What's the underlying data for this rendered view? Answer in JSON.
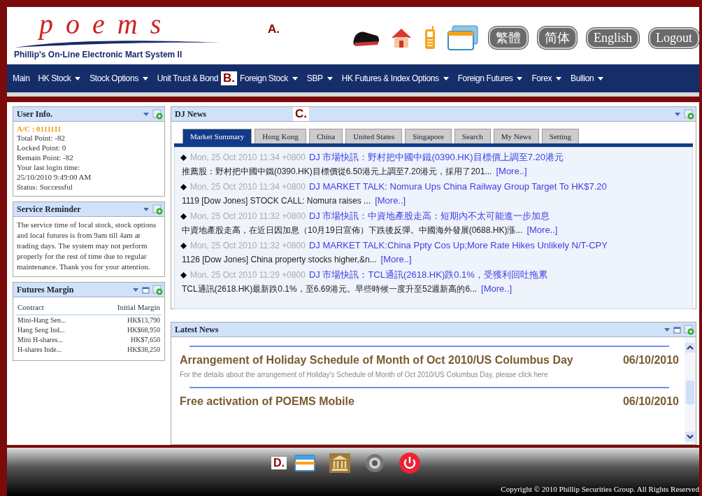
{
  "header": {
    "logo": "poems",
    "logo_subtitle": "Phillip's On-Line Electronic Mart System II",
    "callout": "A.",
    "buttons": [
      "繁體",
      "简体",
      "English",
      "Logout"
    ]
  },
  "nav": {
    "items": [
      {
        "kind": "item",
        "label": "Main",
        "dropdown": false
      },
      {
        "kind": "item",
        "label": "HK Stock",
        "dropdown": true
      },
      {
        "kind": "item",
        "label": "Stock Options",
        "dropdown": true
      },
      {
        "kind": "item",
        "label": "Unit Trust & Bond",
        "dropdown": false
      },
      {
        "kind": "callout",
        "label": "B."
      },
      {
        "kind": "item",
        "label": "Foreign Stock",
        "dropdown": true
      },
      {
        "kind": "item",
        "label": "SBP",
        "dropdown": true
      },
      {
        "kind": "item",
        "label": "HK Futures & Index Options",
        "dropdown": true
      },
      {
        "kind": "item",
        "label": "Foreign Futures",
        "dropdown": true
      },
      {
        "kind": "item",
        "label": "Forex",
        "dropdown": true
      },
      {
        "kind": "item",
        "label": "Bullion",
        "dropdown": true
      }
    ]
  },
  "user_info": {
    "title": "User Info.",
    "account": "A/C : 0111111",
    "lines": [
      "Total Point: -82",
      "Locked Point: 0",
      "Remain Point: -82",
      "Your last login time:",
      "25/10/2010 9:49:00 AM",
      "Status: Successful"
    ]
  },
  "service_reminder": {
    "title": "Service Reminder",
    "text": "The service time of local stock, stock options and local futures is from 9am till 4am at trading days. The system may not perform properly for the rest of time due to regular maintenance. Thank you for your attention."
  },
  "futures_margin": {
    "title": "Futures Margin",
    "columns": [
      "Contract",
      "Initial Margin"
    ],
    "rows": [
      [
        "Mini-Hang Sen...",
        "HK$13,790"
      ],
      [
        "Hang Seng Ind...",
        "HK$68,950"
      ],
      [
        "Mini H-shares...",
        "HK$7,650"
      ],
      [
        "H-shares Inde...",
        "HK$38,250"
      ]
    ]
  },
  "dj_news": {
    "title": "DJ News",
    "callout": "C.",
    "tabs": [
      {
        "label": "Market Summary",
        "selected": true
      },
      {
        "label": "Hong Kong",
        "selected": false
      },
      {
        "label": "China",
        "selected": false
      },
      {
        "label": "United States",
        "selected": false
      },
      {
        "label": "Singapore",
        "selected": false
      },
      {
        "label": "Search",
        "selected": false
      },
      {
        "label": "My News",
        "selected": false
      },
      {
        "label": "Setting",
        "selected": false
      }
    ],
    "items": [
      {
        "time": "Mon, 25 Oct 2010 11:34 +0800",
        "headline": "DJ 市場快訊：野村把中國中鐵(0390.HK)目標價上調至7.20港元",
        "summary": "推薦股：野村把中國中鐵(0390.HK)目標價從6.50港元上調至7.20港元，採用了201...",
        "more": "[More..]"
      },
      {
        "time": "Mon, 25 Oct 2010 11:34 +0800",
        "headline": "DJ MARKET TALK: Nomura Ups China Railway Group Target To HK$7.20",
        "summary": "1119 [Dow Jones] STOCK CALL: Nomura raises ...",
        "more": "[More..]"
      },
      {
        "time": "Mon, 25 Oct 2010 11:32 +0800",
        "headline": "DJ 市場快訊：中資地產股走高：短期內不太可能進一步加息",
        "summary": "中資地產股走高，在近日因加息（10月19日宣佈）下跌後反彈。中國海外發展(0688.HK)漲...",
        "more": "[More..]"
      },
      {
        "time": "Mon, 25 Oct 2010 11:32 +0800",
        "headline": "DJ MARKET TALK:China Ppty Cos Up;More Rate Hikes Unlikely N/T-CPY",
        "summary": "1126 [Dow Jones] China property stocks higher,&n...",
        "more": "[More..]"
      },
      {
        "time": "Mon, 25 Oct 2010 11:29 +0800",
        "headline": "DJ 市場快訊：TCL通訊(2618.HK)跌0.1%，受獲利回吐拖累",
        "summary": "TCL通訊(2618.HK)最新跌0.1%，至6.69港元。早些時候一度升至52週新高的6...",
        "more": "[More..]"
      }
    ]
  },
  "latest_news": {
    "title": "Latest News",
    "items": [
      {
        "title": "Arrangement of Holiday Schedule of Month of Oct 2010/US Columbus Day",
        "date": "06/10/2010",
        "description": "For the details about the arrangement of Holiday's Schedule of Month of Oct 2010/US Columbus Day, please click here"
      },
      {
        "title": "Free activation of POEMS Mobile",
        "date": "06/10/2010"
      }
    ]
  },
  "footer": {
    "callout": "D.",
    "copyright": "Copyright © 2010 Phillip Securities Group. All Rights Reserved"
  }
}
